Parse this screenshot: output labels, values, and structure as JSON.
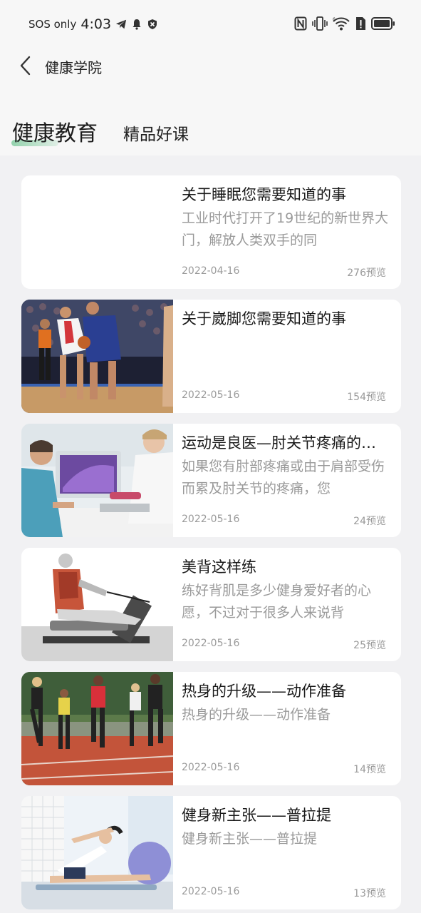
{
  "status_bar": {
    "carrier": "SOS only",
    "time": "4:03"
  },
  "app_bar": {
    "title": "健康学院"
  },
  "tabs": [
    {
      "label": "健康教育",
      "active": true
    },
    {
      "label": "精品好课",
      "active": false
    }
  ],
  "colors": {
    "accent_underline": "#82cca0",
    "card_bg": "#ffffff",
    "page_bg": "#f1f1f3"
  },
  "articles": [
    {
      "title": "关于睡眠您需要知道的事",
      "desc": "工业时代打开了19世纪的新世界大门，解放人类双手的同",
      "date": "2022-04-16",
      "views": "276预览"
    },
    {
      "title": "关于崴脚您需要知道的事",
      "desc": "",
      "date": "2022-05-16",
      "views": "154预览"
    },
    {
      "title": "运动是良医—肘关节疼痛的…",
      "desc": "如果您有肘部疼痛或由于肩部受伤而累及肘关节的疼痛，您",
      "date": "2022-05-16",
      "views": "24预览"
    },
    {
      "title": "美背这样练",
      "desc": "练好背肌是多少健身爱好者的心愿，不过对于很多人来说背",
      "date": "2022-05-16",
      "views": "25预览"
    },
    {
      "title": "热身的升级——动作准备",
      "desc": "热身的升级——动作准备",
      "date": "2022-05-16",
      "views": "14预览"
    },
    {
      "title": "健身新主张——普拉提",
      "desc": "健身新主张——普拉提",
      "date": "2022-05-16",
      "views": "13预览"
    }
  ]
}
